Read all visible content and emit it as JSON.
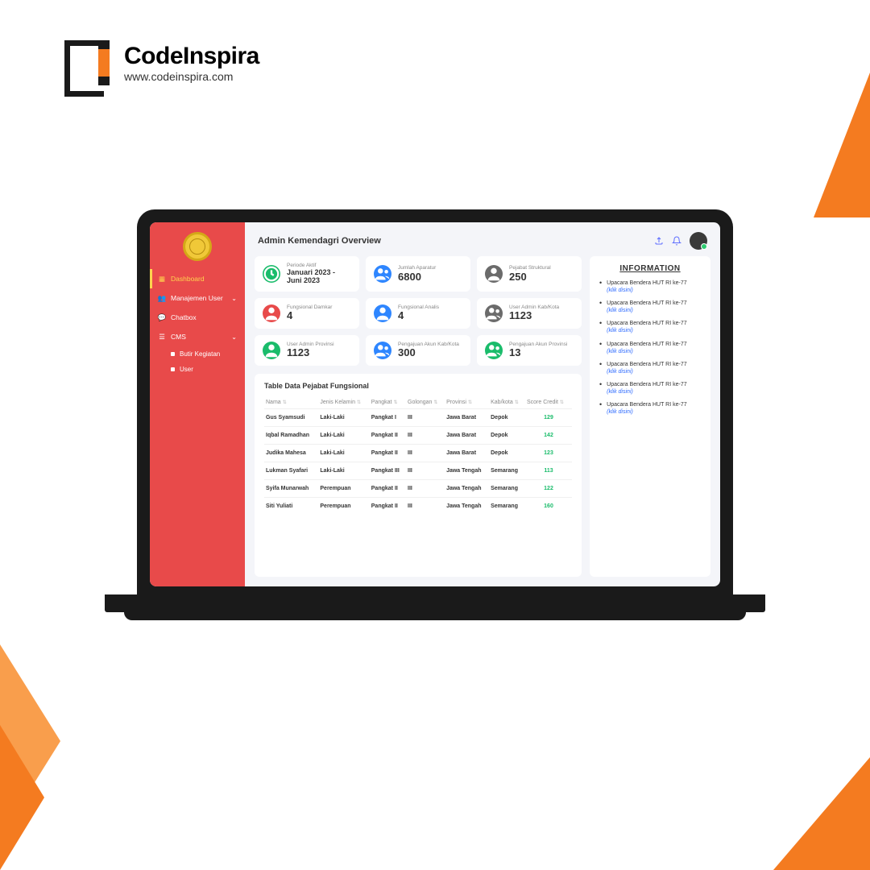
{
  "brand": {
    "name": "CodeInspira",
    "url": "www.codeinspira.com"
  },
  "app": {
    "title": "Admin Kemendagri Overview",
    "sidebar": {
      "items": [
        {
          "label": "Dashboard",
          "active": true
        },
        {
          "label": "Manajemen User",
          "chev": true
        },
        {
          "label": "Chatbox"
        },
        {
          "label": "CMS",
          "chev": true,
          "sub": [
            "Butir Kegiatan",
            "User"
          ]
        }
      ]
    },
    "cards": [
      {
        "label": "Periode Aktif",
        "value": "Januari 2023 - Juni 2023",
        "color": "green",
        "small": true
      },
      {
        "label": "Jumlah Aparatur",
        "value": "6800",
        "color": "blue"
      },
      {
        "label": "Pejabat Struktural",
        "value": "250",
        "color": "gray"
      },
      {
        "label": "Fungsional Damkar",
        "value": "4",
        "color": "red"
      },
      {
        "label": "Fungsional Analis",
        "value": "4",
        "color": "blue"
      },
      {
        "label": "User Admin Kab/Kota",
        "value": "1123",
        "color": "gray"
      },
      {
        "label": "User Admin Provinsi",
        "value": "1123",
        "color": "green"
      },
      {
        "label": "Pengajuan Akun Kab/Kota",
        "value": "300",
        "color": "blue"
      },
      {
        "label": "Pengajuan Akun Provinsi",
        "value": "13",
        "color": "green"
      }
    ],
    "table": {
      "title": "Table Data Pejabat Fungsional",
      "headers": [
        "Nama",
        "Jenis Kelamin",
        "Pangkat",
        "Golongan",
        "Provinsi",
        "Kab/kota",
        "Score Credit"
      ],
      "rows": [
        [
          "Gus Syamsudi",
          "Laki-Laki",
          "Pangkat I",
          "III",
          "Jawa Barat",
          "Depok",
          "129"
        ],
        [
          "Iqbal Ramadhan",
          "Laki-Laki",
          "Pangkat II",
          "III",
          "Jawa Barat",
          "Depok",
          "142"
        ],
        [
          "Judika Mahesa",
          "Laki-Laki",
          "Pangkat II",
          "III",
          "Jawa Barat",
          "Depok",
          "123"
        ],
        [
          "Lukman Syafari",
          "Laki-Laki",
          "Pangkat III",
          "III",
          "Jawa Tengah",
          "Semarang",
          "113"
        ],
        [
          "Syifa Munarwah",
          "Perempuan",
          "Pangkat II",
          "III",
          "Jawa Tengah",
          "Semarang",
          "122"
        ],
        [
          "Siti Yuliati",
          "Perempuan",
          "Pangkat II",
          "III",
          "Jawa Tengah",
          "Semarang",
          "160"
        ]
      ]
    },
    "info": {
      "title": "INFORMATION",
      "link_text": "(klik disini)",
      "items": [
        "Upacara Bendera HUT RI ke-77",
        "Upacara Bendera HUT RI ke-77",
        "Upacara Bendera HUT RI ke-77",
        "Upacara Bendera HUT RI ke-77",
        "Upacara Bendera HUT RI ke-77",
        "Upacara Bendera HUT RI ke-77",
        "Upacara Bendera HUT RI ke-77"
      ]
    }
  }
}
